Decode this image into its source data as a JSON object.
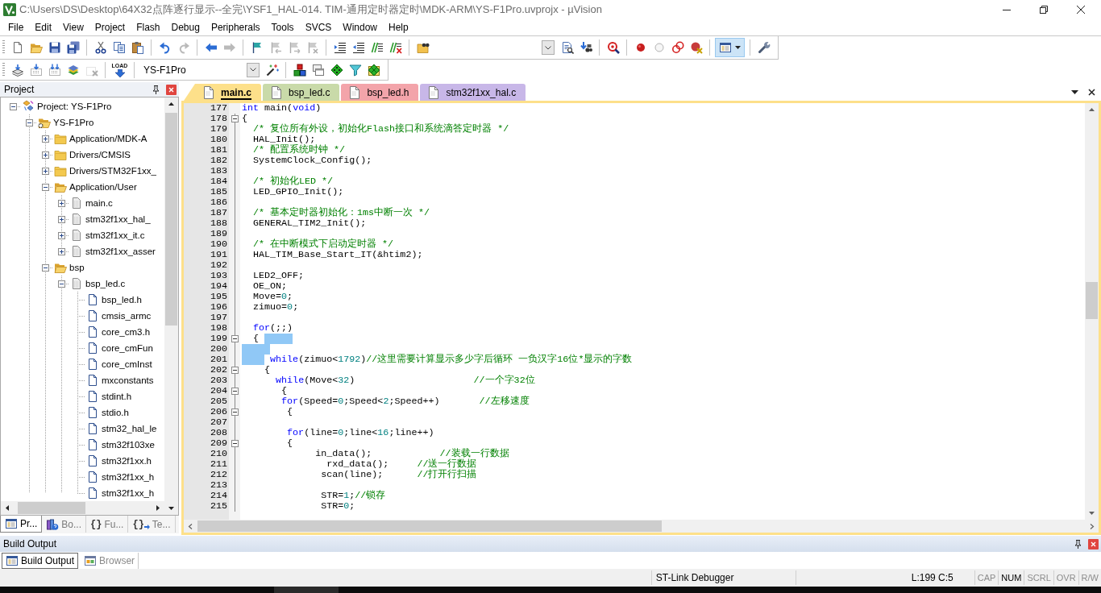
{
  "window": {
    "title": "C:\\Users\\DS\\Desktop\\64X32点阵逐行显示--全完\\YSF1_HAL-014. TIM-通用定时器定时\\MDK-ARM\\YS-F1Pro.uvprojx - µVision"
  },
  "menu": [
    "File",
    "Edit",
    "View",
    "Project",
    "Flash",
    "Debug",
    "Peripherals",
    "Tools",
    "SVCS",
    "Window",
    "Help"
  ],
  "toolbars": [
    {
      "groups": [
        {
          "items": [
            {
              "kind": "blank-page",
              "disabled": false,
              "pressed": false
            },
            {
              "kind": "open-folder",
              "disabled": false,
              "pressed": false
            },
            {
              "kind": "floppy-disk",
              "disabled": false,
              "pressed": false
            },
            {
              "kind": "floppy-disks",
              "disabled": false,
              "pressed": false
            }
          ]
        },
        {
          "items": [
            {
              "kind": "scissors",
              "disabled": false,
              "pressed": false
            },
            {
              "kind": "copy-pages",
              "disabled": false,
              "pressed": false
            },
            {
              "kind": "clipboard",
              "disabled": false,
              "pressed": false
            }
          ]
        },
        {
          "items": [
            {
              "kind": "undo-arrow",
              "disabled": false,
              "pressed": false
            },
            {
              "kind": "redo-arrow",
              "disabled": true,
              "pressed": false
            }
          ]
        },
        {
          "items": [
            {
              "kind": "left-arrow",
              "disabled": false,
              "pressed": false
            },
            {
              "kind": "right-arrow",
              "disabled": true,
              "pressed": false
            }
          ]
        },
        {
          "items": [
            {
              "kind": "flag",
              "disabled": false,
              "pressed": false
            },
            {
              "kind": "flag-left",
              "disabled": true,
              "pressed": false
            },
            {
              "kind": "flag-right",
              "disabled": true,
              "pressed": false
            },
            {
              "kind": "flag-cross",
              "disabled": true,
              "pressed": false
            }
          ]
        },
        {
          "items": [
            {
              "kind": "indent-lines",
              "disabled": false,
              "pressed": false
            },
            {
              "kind": "outdent-lines",
              "disabled": false,
              "pressed": false
            },
            {
              "kind": "comment-lines",
              "disabled": false,
              "pressed": false
            },
            {
              "kind": "uncomment-lines",
              "disabled": false,
              "pressed": false
            }
          ]
        },
        {
          "items": [
            {
              "kind": "folder-binoculars",
              "disabled": false,
              "pressed": false
            },
            {
              "kind": "combo",
              "disabled": false,
              "pressed": false
            },
            {
              "kind": "page-search",
              "disabled": false,
              "pressed": false
            },
            {
              "kind": "binoculars-arrow",
              "disabled": false,
              "pressed": false
            }
          ]
        },
        {
          "items": [
            {
              "kind": "magnifier",
              "disabled": false,
              "pressed": false
            }
          ]
        },
        {
          "items": [
            {
              "kind": "filled-circle",
              "disabled": false,
              "pressed": false
            },
            {
              "kind": "hollow-circle",
              "disabled": false,
              "pressed": false
            },
            {
              "kind": "double-ring",
              "disabled": false,
              "pressed": false
            },
            {
              "kind": "circle-cross",
              "disabled": false,
              "pressed": false
            }
          ]
        },
        {
          "items": [
            {
              "kind": "layout-menu",
              "disabled": false,
              "pressed": true
            }
          ]
        },
        {
          "items": [
            {
              "kind": "wrench",
              "disabled": false,
              "pressed": false
            }
          ]
        }
      ]
    },
    {
      "groups": [
        {
          "items": [
            {
              "kind": "stack-arrow",
              "disabled": false,
              "pressed": false
            },
            {
              "kind": "arrow-box",
              "disabled": false,
              "pressed": false
            },
            {
              "kind": "double-arrow-box",
              "disabled": false,
              "pressed": false
            },
            {
              "kind": "layers",
              "disabled": false,
              "pressed": false
            },
            {
              "kind": "box-cross",
              "disabled": true,
              "pressed": false
            }
          ]
        },
        {
          "items": [
            {
              "kind": "download",
              "label": "LOAD",
              "disabled": false,
              "pressed": false
            }
          ]
        },
        {
          "items": [
            {
              "kind": "combo",
              "value": "YS-F1Pro",
              "disabled": false,
              "pressed": false
            },
            {
              "kind": "magic-wand",
              "disabled": false,
              "pressed": false
            }
          ]
        },
        {
          "items": [
            {
              "kind": "cubes",
              "disabled": false,
              "pressed": false
            },
            {
              "kind": "windows",
              "disabled": false,
              "pressed": false
            },
            {
              "kind": "diamond",
              "disabled": false,
              "pressed": false
            },
            {
              "kind": "funnel",
              "disabled": false,
              "pressed": false
            },
            {
              "kind": "diamond-grid",
              "disabled": false,
              "pressed": false
            }
          ]
        }
      ]
    }
  ],
  "project_panel": {
    "title": "Project",
    "tree": [
      {
        "label": "Project: YS-F1Pro",
        "kind": "project",
        "expanded": true,
        "children": [
          {
            "label": "YS-F1Pro",
            "kind": "target",
            "expanded": true,
            "children": [
              {
                "label": "Application/MDK-A",
                "kind": "folder",
                "expanded": false
              },
              {
                "label": "Drivers/CMSIS",
                "kind": "folder",
                "expanded": false
              },
              {
                "label": "Drivers/STM32F1xx_",
                "kind": "folder",
                "expanded": false
              },
              {
                "label": "Application/User",
                "kind": "folder",
                "expanded": true,
                "children": [
                  {
                    "label": "main.c",
                    "kind": "source",
                    "expanded": false
                  },
                  {
                    "label": "stm32f1xx_hal_",
                    "kind": "source",
                    "expanded": false
                  },
                  {
                    "label": "stm32f1xx_it.c",
                    "kind": "source",
                    "expanded": false
                  },
                  {
                    "label": "stm32f1xx_asser",
                    "kind": "source",
                    "expanded": false
                  }
                ]
              },
              {
                "label": "bsp",
                "kind": "folder",
                "expanded": true,
                "children": [
                  {
                    "label": "bsp_led.c",
                    "kind": "source",
                    "expanded": true,
                    "children": [
                      {
                        "label": "bsp_led.h",
                        "kind": "header"
                      },
                      {
                        "label": "cmsis_armc",
                        "kind": "header"
                      },
                      {
                        "label": "core_cm3.h",
                        "kind": "header"
                      },
                      {
                        "label": "core_cmFun",
                        "kind": "header"
                      },
                      {
                        "label": "core_cmInst",
                        "kind": "header"
                      },
                      {
                        "label": "mxconstants",
                        "kind": "header"
                      },
                      {
                        "label": "stdint.h",
                        "kind": "header"
                      },
                      {
                        "label": "stdio.h",
                        "kind": "header"
                      },
                      {
                        "label": "stm32_hal_le",
                        "kind": "header"
                      },
                      {
                        "label": "stm32f103xe",
                        "kind": "header"
                      },
                      {
                        "label": "stm32f1xx.h",
                        "kind": "header"
                      },
                      {
                        "label": "stm32f1xx_h",
                        "kind": "header"
                      },
                      {
                        "label": "stm32f1xx_h",
                        "kind": "header"
                      }
                    ]
                  }
                ]
              }
            ]
          }
        ]
      }
    ],
    "tabs": [
      {
        "label": "Pr...",
        "kind": "project",
        "selected": true
      },
      {
        "label": "Bo...",
        "kind": "books",
        "selected": false
      },
      {
        "label": "Fu...",
        "kind": "functions",
        "glyph": "{}",
        "selected": false
      },
      {
        "label": "Te...",
        "kind": "templates",
        "glyph": "{}",
        "selected": false
      }
    ]
  },
  "editor": {
    "tabs": [
      {
        "label": "main.c",
        "color": "#fde08a",
        "selected": true
      },
      {
        "label": "bsp_led.c",
        "color": "#c9daa9",
        "selected": false
      },
      {
        "label": "bsp_led.h",
        "color": "#f3a4aa",
        "selected": false
      },
      {
        "label": "stm32f1xx_hal.c",
        "color": "#c8b7e8",
        "selected": false
      }
    ],
    "lines": [
      {
        "number": "177",
        "fold_marker": false,
        "selected": false,
        "tokens": [
          {
            "kind": "keyword",
            "text": "int"
          },
          {
            "kind": "code",
            "text": " main("
          },
          {
            "kind": "keyword",
            "text": "void"
          },
          {
            "kind": "code",
            "text": ")"
          }
        ]
      },
      {
        "number": "178",
        "fold_marker": true,
        "selected": false,
        "tokens": [
          {
            "kind": "code",
            "text": "{"
          }
        ]
      },
      {
        "number": "179",
        "fold_marker": false,
        "selected": false,
        "tokens": [
          {
            "kind": "comment",
            "text": "  /* 复位所有外设，初始化Flash接口和系统滴答定时器 */"
          }
        ]
      },
      {
        "number": "180",
        "fold_marker": false,
        "selected": false,
        "tokens": [
          {
            "kind": "code",
            "text": "  HAL_Init();"
          }
        ]
      },
      {
        "number": "181",
        "fold_marker": false,
        "selected": false,
        "tokens": [
          {
            "kind": "comment",
            "text": "  /* 配置系统时钟 */"
          }
        ]
      },
      {
        "number": "182",
        "fold_marker": false,
        "selected": false,
        "tokens": [
          {
            "kind": "code",
            "text": "  SystemClock_Config();"
          }
        ]
      },
      {
        "number": "183",
        "fold_marker": false,
        "selected": false
      },
      {
        "number": "184",
        "fold_marker": false,
        "selected": false,
        "tokens": [
          {
            "kind": "comment",
            "text": "  /* 初始化LED */"
          }
        ]
      },
      {
        "number": "185",
        "fold_marker": false,
        "selected": false,
        "tokens": [
          {
            "kind": "code",
            "text": "  LED_GPIO_Init();"
          }
        ]
      },
      {
        "number": "186",
        "fold_marker": false,
        "selected": false
      },
      {
        "number": "187",
        "fold_marker": false,
        "selected": false,
        "tokens": [
          {
            "kind": "comment",
            "text": "  /* 基本定时器初始化：1ms中断一次 */"
          }
        ]
      },
      {
        "number": "188",
        "fold_marker": false,
        "selected": false,
        "tokens": [
          {
            "kind": "code",
            "text": "  GENERAL_TIM2_Init();"
          }
        ]
      },
      {
        "number": "189",
        "fold_marker": false,
        "selected": false
      },
      {
        "number": "190",
        "fold_marker": false,
        "selected": false,
        "tokens": [
          {
            "kind": "comment",
            "text": "  /* 在中断模式下启动定时器 */"
          }
        ]
      },
      {
        "number": "191",
        "fold_marker": false,
        "selected": false,
        "tokens": [
          {
            "kind": "code",
            "text": "  HAL_TIM_Base_Start_IT(&htim2);"
          }
        ]
      },
      {
        "number": "192",
        "fold_marker": false,
        "selected": false
      },
      {
        "number": "193",
        "fold_marker": false,
        "selected": false,
        "tokens": [
          {
            "kind": "code",
            "text": "  LED2_OFF;"
          }
        ]
      },
      {
        "number": "194",
        "fold_marker": false,
        "selected": false,
        "tokens": [
          {
            "kind": "code",
            "text": "  OE_ON;"
          }
        ]
      },
      {
        "number": "195",
        "fold_marker": false,
        "selected": false,
        "tokens": [
          {
            "kind": "code",
            "text": "  Move="
          },
          {
            "kind": "number",
            "text": "0"
          },
          {
            "kind": "code",
            "text": ";"
          }
        ]
      },
      {
        "number": "196",
        "fold_marker": false,
        "selected": false,
        "tokens": [
          {
            "kind": "code",
            "text": "  zimuo="
          },
          {
            "kind": "number",
            "text": "0"
          },
          {
            "kind": "code",
            "text": ";"
          }
        ]
      },
      {
        "number": "197",
        "fold_marker": false,
        "selected": false
      },
      {
        "number": "198",
        "fold_marker": false,
        "selected": false,
        "tokens": [
          {
            "kind": "keyword",
            "text": "  for"
          },
          {
            "kind": "code",
            "text": "(;;)"
          }
        ]
      },
      {
        "number": "199",
        "fold_marker": true,
        "selected": true,
        "tokens": [
          {
            "kind": "code",
            "text": "  { "
          }
        ]
      },
      {
        "number": "200",
        "fold_marker": false,
        "selected": true
      },
      {
        "number": "201",
        "fold_marker": false,
        "selected": true,
        "tokens": [
          {
            "kind": "keyword",
            "text": "     while"
          },
          {
            "kind": "code",
            "text": "(zimuo<"
          },
          {
            "kind": "number",
            "text": "1792"
          },
          {
            "kind": "code",
            "text": ")"
          },
          {
            "kind": "comment",
            "text": "//这里需要计算显示多少字后循环 一负汉字16位*显示的字数"
          }
        ]
      },
      {
        "number": "202",
        "fold_marker": true,
        "selected": false,
        "tokens": [
          {
            "kind": "code",
            "text": "    {"
          }
        ]
      },
      {
        "number": "203",
        "fold_marker": false,
        "selected": false,
        "tokens": [
          {
            "kind": "keyword",
            "text": "      while"
          },
          {
            "kind": "code",
            "text": "(Move<"
          },
          {
            "kind": "number",
            "text": "32"
          },
          {
            "kind": "code",
            "text": ")                     "
          },
          {
            "kind": "comment",
            "text": "//一个字32位"
          }
        ]
      },
      {
        "number": "204",
        "fold_marker": true,
        "selected": false,
        "tokens": [
          {
            "kind": "code",
            "text": "       {"
          }
        ]
      },
      {
        "number": "205",
        "fold_marker": false,
        "selected": false,
        "tokens": [
          {
            "kind": "keyword",
            "text": "       for"
          },
          {
            "kind": "code",
            "text": "(Speed="
          },
          {
            "kind": "number",
            "text": "0"
          },
          {
            "kind": "code",
            "text": ";Speed<"
          },
          {
            "kind": "number",
            "text": "2"
          },
          {
            "kind": "code",
            "text": ";Speed++)       "
          },
          {
            "kind": "comment",
            "text": "//左移速度"
          }
        ]
      },
      {
        "number": "206",
        "fold_marker": true,
        "selected": false,
        "tokens": [
          {
            "kind": "code",
            "text": "        {"
          }
        ]
      },
      {
        "number": "207",
        "fold_marker": false,
        "selected": false
      },
      {
        "number": "208",
        "fold_marker": false,
        "selected": false,
        "tokens": [
          {
            "kind": "keyword",
            "text": "        for"
          },
          {
            "kind": "code",
            "text": "(line="
          },
          {
            "kind": "number",
            "text": "0"
          },
          {
            "kind": "code",
            "text": ";line<"
          },
          {
            "kind": "number",
            "text": "16"
          },
          {
            "kind": "code",
            "text": ";line++)"
          }
        ]
      },
      {
        "number": "209",
        "fold_marker": true,
        "selected": false,
        "tokens": [
          {
            "kind": "code",
            "text": "        {"
          }
        ]
      },
      {
        "number": "210",
        "fold_marker": false,
        "selected": false,
        "tokens": [
          {
            "kind": "code",
            "text": "             in_data();            "
          },
          {
            "kind": "comment",
            "text": "//装载一行数据"
          }
        ]
      },
      {
        "number": "211",
        "fold_marker": false,
        "selected": false,
        "tokens": [
          {
            "kind": "code",
            "text": "               rxd_data();     "
          },
          {
            "kind": "comment",
            "text": "//送一行数据"
          }
        ]
      },
      {
        "number": "212",
        "fold_marker": false,
        "selected": false,
        "tokens": [
          {
            "kind": "code",
            "text": "              scan(line);      "
          },
          {
            "kind": "comment",
            "text": "//打开行扫描"
          }
        ]
      },
      {
        "number": "213",
        "fold_marker": false,
        "selected": false
      },
      {
        "number": "214",
        "fold_marker": false,
        "selected": false,
        "tokens": [
          {
            "kind": "code",
            "text": "              STR="
          },
          {
            "kind": "number",
            "text": "1"
          },
          {
            "kind": "code",
            "text": ";"
          },
          {
            "kind": "comment",
            "text": "//锁存"
          }
        ]
      },
      {
        "number": "215",
        "fold_marker": false,
        "selected": false,
        "tokens": [
          {
            "kind": "code",
            "text": "              STR="
          },
          {
            "kind": "number",
            "text": "0"
          },
          {
            "kind": "code",
            "text": ";"
          }
        ]
      }
    ]
  },
  "build_output": {
    "title": "Build Output",
    "tabs": [
      {
        "label": "Build Output",
        "kind": "output",
        "selected": true
      },
      {
        "label": "Browser",
        "kind": "browser",
        "selected": false
      }
    ]
  },
  "status_bar": {
    "debugger": "ST-Link Debugger",
    "position": "L:199 C:5",
    "indicators": [
      {
        "label": "CAP",
        "on": false
      },
      {
        "label": "NUM",
        "on": true
      },
      {
        "label": "SCRL",
        "on": false
      },
      {
        "label": "OVR",
        "on": false
      },
      {
        "label": "R/W",
        "on": false
      }
    ]
  }
}
